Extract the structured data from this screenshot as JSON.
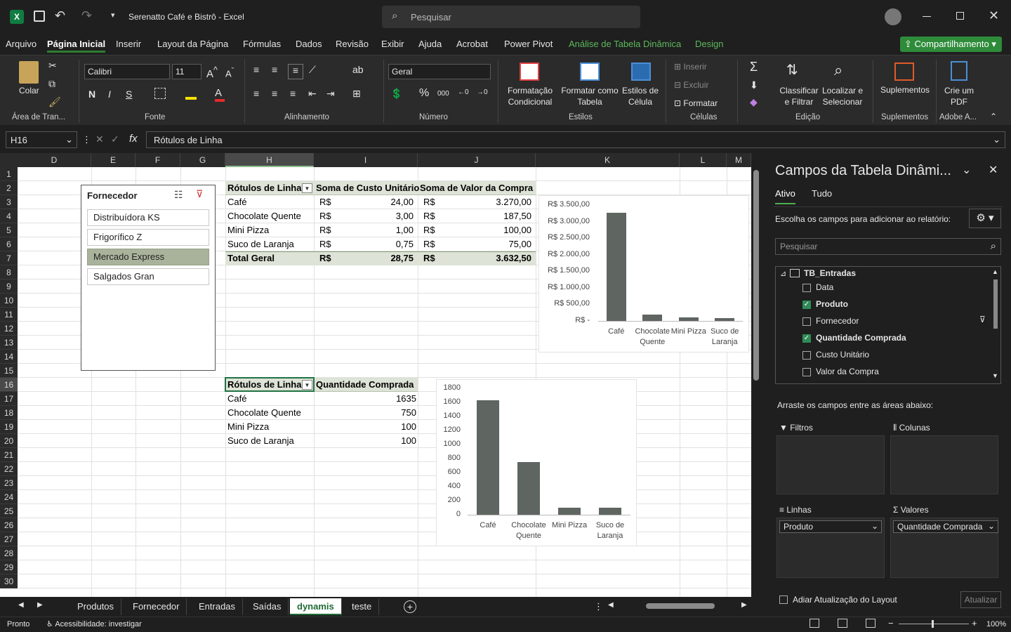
{
  "window": {
    "title": "Serenatto Café e Bistrô  -  Excel",
    "search_placeholder": "Pesquisar"
  },
  "menu": {
    "items": [
      "Arquivo",
      "Página Inicial",
      "Inserir",
      "Layout da Página",
      "Fórmulas",
      "Dados",
      "Revisão",
      "Exibir",
      "Ajuda",
      "Acrobat",
      "Power Pivot",
      "Análise de Tabela Dinâmica",
      "Design"
    ],
    "share_label": "Compartilhamento"
  },
  "ribbon": {
    "paste_label": "Colar",
    "clipboard_label": "Área de Tran...",
    "font_name": "Calibri",
    "font_size": "11",
    "font_label": "Fonte",
    "bold": "N",
    "italic": "I",
    "underline": "S",
    "align_label": "Alinhamento",
    "number_format": "Geral",
    "number_label": "Número",
    "cond_format": "Formatação Condicional",
    "format_table": "Formatar como Tabela",
    "cell_styles": "Estilos de Célula",
    "styles_label": "Estilos",
    "insert": "Inserir",
    "delete": "Excluir",
    "format": "Formatar",
    "cells_label": "Células",
    "sort_filter": "Classificar e Filtrar",
    "find_select": "Localizar e Selecionar",
    "editing_label": "Edição",
    "addins": "Suplementos",
    "addins_label": "Suplementos",
    "create_pdf": "Crie um PDF",
    "adobe_label": "Adobe A..."
  },
  "formula_bar": {
    "name_box": "H16",
    "content": "Rótulos de Linha"
  },
  "columns": [
    "D",
    "E",
    "F",
    "G",
    "H",
    "I",
    "J",
    "K",
    "L",
    "M"
  ],
  "rows": [
    "1",
    "2",
    "3",
    "4",
    "5",
    "6",
    "7",
    "8",
    "9",
    "10",
    "11",
    "12",
    "13",
    "14",
    "15",
    "16",
    "17",
    "18",
    "19",
    "20",
    "21",
    "22",
    "23",
    "24",
    "25",
    "26",
    "27",
    "28",
    "29",
    "30"
  ],
  "slicer": {
    "title": "Fornecedor",
    "items": [
      "Distribuídora KS",
      "Frigorífico Z",
      "Mercado Express",
      "Salgados Gran"
    ],
    "selected": "Mercado Express"
  },
  "pivot1": {
    "headers": [
      "Rótulos de Linha",
      "Soma de Custo Unitário",
      "Soma de Valor da Compra"
    ],
    "currency": "R$",
    "rows": [
      {
        "label": "Café",
        "cost": "24,00",
        "value": "3.270,00"
      },
      {
        "label": "Chocolate Quente",
        "cost": "3,00",
        "value": "187,50"
      },
      {
        "label": "Mini Pizza",
        "cost": "1,00",
        "value": "100,00"
      },
      {
        "label": "Suco de Laranja",
        "cost": "0,75",
        "value": "75,00"
      }
    ],
    "total": {
      "label": "Total Geral",
      "cost": "28,75",
      "value": "3.632,50"
    }
  },
  "pivot2": {
    "headers": [
      "Rótulos de Linha",
      "Quantidade Comprada"
    ],
    "rows": [
      {
        "label": "Café",
        "qty": "1635"
      },
      {
        "label": "Chocolate Quente",
        "qty": "750"
      },
      {
        "label": "Mini Pizza",
        "qty": "100"
      },
      {
        "label": "Suco de Laranja",
        "qty": "100"
      }
    ]
  },
  "chart_data": [
    {
      "type": "bar",
      "categories": [
        "Café",
        "Chocolate Quente",
        "Mini Pizza",
        "Suco de Laranja"
      ],
      "values": [
        3270,
        187.5,
        100,
        75
      ],
      "ylim": [
        0,
        3500
      ],
      "yticks": [
        "R$ 3.500,00",
        "R$ 3.000,00",
        "R$ 2.500,00",
        "R$ 2.000,00",
        "R$ 1.500,00",
        "R$ 1.000,00",
        "R$ 500,00",
        "R$ -"
      ],
      "color": "#5f6560",
      "grid": false
    },
    {
      "type": "bar",
      "categories": [
        "Café",
        "Chocolate Quente",
        "Mini Pizza",
        "Suco de Laranja"
      ],
      "values": [
        1635,
        750,
        100,
        100
      ],
      "ylim": [
        0,
        1800
      ],
      "yticks": [
        "1800",
        "1600",
        "1400",
        "1200",
        "1000",
        "800",
        "600",
        "400",
        "200",
        "0"
      ],
      "color": "#5f6560",
      "grid": false
    }
  ],
  "sheet_tabs": {
    "tabs": [
      "Produtos",
      "Fornecedor",
      "Entradas",
      "Saídas",
      "dynamis",
      "teste"
    ],
    "active": "dynamis"
  },
  "status": {
    "ready": "Pronto",
    "accessibility": "Acessibilidade: investigar",
    "zoom": "100%"
  },
  "pivot_panel": {
    "title": "Campos da Tabela Dinâmi...",
    "tab_active": "Ativo",
    "tab_all": "Tudo",
    "choose_text": "Escolha os campos para adicionar ao relatório:",
    "search_placeholder": "Pesquisar",
    "table_name": "TB_Entradas",
    "fields": [
      {
        "name": "Data",
        "checked": false
      },
      {
        "name": "Produto",
        "checked": true
      },
      {
        "name": "Fornecedor",
        "checked": false
      },
      {
        "name": "Quantidade Comprada",
        "checked": true
      },
      {
        "name": "Custo Unitário",
        "checked": false
      },
      {
        "name": "Valor da Compra",
        "checked": false
      }
    ],
    "drag_text": "Arraste os campos entre as áreas abaixo:",
    "filters_label": "Filtros",
    "columns_label": "Colunas",
    "rows_label": "Linhas",
    "values_label": "Valores",
    "rows_field": "Produto",
    "values_field": "Quantidade Comprada",
    "defer_label": "Adiar Atualização do Layout",
    "update_button": "Atualizar"
  },
  "accent_color": "#2e7d32",
  "share_color": "#2e8b3a",
  "selected_slicer_color": "#a9b39b",
  "pivot_header_color": "#dde3d6"
}
